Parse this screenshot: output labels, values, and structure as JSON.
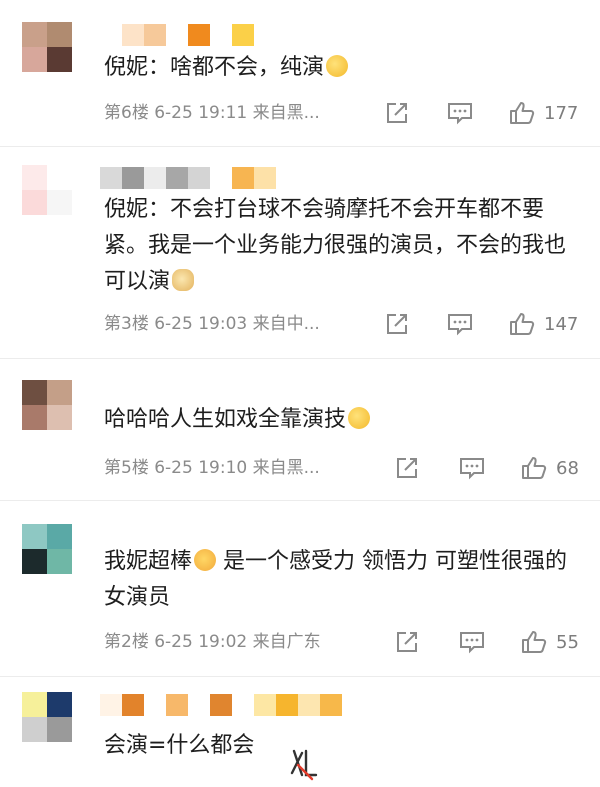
{
  "comments": [
    {
      "text": "倪妮：啥都不会，纯演",
      "emoji": "thinking-emoji",
      "floor": "第6楼",
      "time": "6-25 19:11",
      "location": "来自黑...",
      "likes": "177",
      "avatar_colors": [
        "#c9a08a",
        "#b08b70",
        "#d7a79b",
        "#5a3a33"
      ],
      "name_blur_colors": [
        "#ffffff",
        "#fde3c8",
        "#f6c99a",
        "#ffffff",
        "#f08a1e",
        "#ffffff",
        "#fbd048"
      ]
    },
    {
      "text": "倪妮：不会打台球不会骑摩托不会开车都不要紧。我是一个业务能力很强的演员，不会的我也可以演",
      "emoji": "doge-emoji",
      "floor": "第3楼",
      "time": "6-25 19:03",
      "location": "来自中...",
      "likes": "147",
      "avatar_colors": [
        "#fdeaea",
        "#ffffff",
        "#fbdada",
        "#f6f6f6"
      ],
      "name_blur_colors": [
        "#d9d9d9",
        "#9a9a9a",
        "#ececec",
        "#a7a7a7",
        "#d4d4d4",
        "#ffffff",
        "#f7b551",
        "#fde1a8"
      ]
    },
    {
      "text": "哈哈哈人生如戏全靠演技",
      "emoji": "thinking-emoji",
      "floor": "第5楼",
      "time": "6-25 19:10",
      "location": "来自黑...",
      "likes": "68",
      "avatar_colors": [
        "#6e4f41",
        "#c49f88",
        "#a97a6a",
        "#ddbfb0"
      ]
    },
    {
      "text": "我妮超棒",
      "text_after": "是一个感受力 领悟力 可塑性很强的女演员",
      "emoji": "shocked-emoji",
      "floor": "第2楼",
      "time": "6-25 19:02",
      "location": "来自广东",
      "likes": "55",
      "avatar_colors": [
        "#8ec8c3",
        "#5aa9a6",
        "#1c2a2c",
        "#6fb7a6"
      ]
    },
    {
      "text": "会演=什么都会",
      "avatar_colors": [
        "#f6f09a",
        "#1d3a6b",
        "#cfcfcf",
        "#9a9a9a"
      ],
      "name_blur_colors": [
        "#fff3e6",
        "#e2832b",
        "#ffffff",
        "#f7b86a",
        "#ffffff",
        "#e0852f",
        "#ffffff",
        "#fde7a4",
        "#f6b52e",
        "#fde6b0",
        "#f7b84a"
      ]
    }
  ],
  "icon_color": "#8a8a8a"
}
